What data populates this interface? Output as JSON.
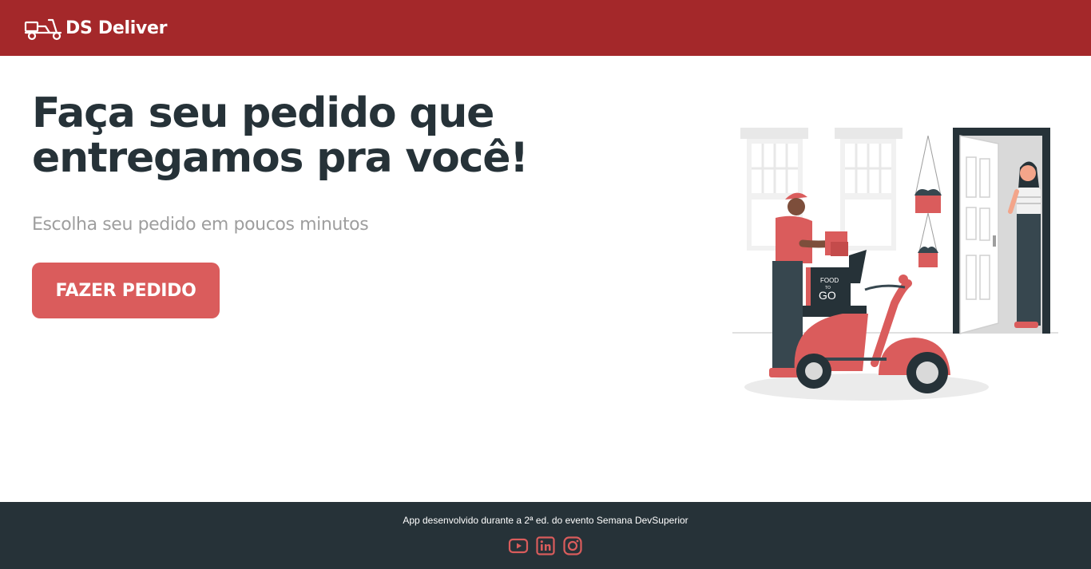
{
  "navbar": {
    "brand_logo_icon": "delivery-scooter-icon",
    "brand_name": "DS Deliver"
  },
  "home": {
    "title": "Faça seu pedido que entregamos pra você!",
    "subtitle": "Escolha seu pedido em poucos minutos",
    "cta_label": "FAZER PEDIDO",
    "illustration_text": {
      "food": "FOOD",
      "to": "TO",
      "go": "GO"
    }
  },
  "footer": {
    "text": "App desenvolvido durante a 2ª ed. do evento Semana DevSuperior",
    "social": [
      {
        "icon": "youtube-icon"
      },
      {
        "icon": "linkedin-icon"
      },
      {
        "icon": "instagram-icon"
      }
    ]
  },
  "colors": {
    "navbar_bg": "#a4282a",
    "primary": "#da5c5c",
    "dark": "#263238",
    "muted": "#9e9e9e"
  }
}
